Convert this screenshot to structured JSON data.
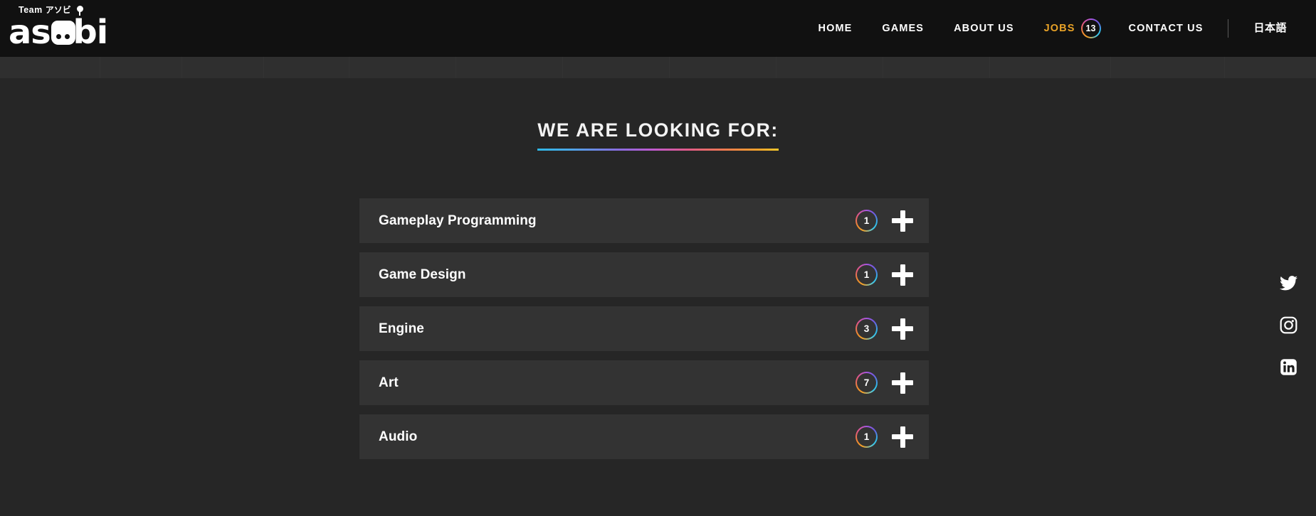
{
  "header": {
    "logo": {
      "team_text": "Team",
      "kana_text": "アソビ",
      "word": "asobi"
    },
    "nav": [
      {
        "label": "HOME",
        "active": false
      },
      {
        "label": "GAMES",
        "active": false
      },
      {
        "label": "ABOUT US",
        "active": false
      },
      {
        "label": "JOBS",
        "active": true,
        "badge": "13"
      },
      {
        "label": "CONTACT US",
        "active": false
      }
    ],
    "language_label": "日本語"
  },
  "main": {
    "heading": "WE ARE LOOKING FOR:",
    "jobs": [
      {
        "title": "Gameplay Programming",
        "count": "1",
        "expand_icon": "plus-icon"
      },
      {
        "title": "Game Design",
        "count": "1",
        "expand_icon": "plus-icon"
      },
      {
        "title": "Engine",
        "count": "3",
        "expand_icon": "plus-icon"
      },
      {
        "title": "Art",
        "count": "7",
        "expand_icon": "plus-icon"
      },
      {
        "title": "Audio",
        "count": "1",
        "expand_icon": "plus-icon"
      }
    ]
  },
  "social": [
    {
      "name": "twitter-icon",
      "label": "Twitter"
    },
    {
      "name": "instagram-icon",
      "label": "Instagram"
    },
    {
      "name": "linkedin-icon",
      "label": "LinkedIn"
    }
  ],
  "colors": {
    "header_bg": "#111111",
    "page_bg": "#262626",
    "subbar_bg": "#2f2f2f",
    "card_bg": "#333333",
    "accent_active": "#e8a227",
    "gradient_start": "#2fb8e6",
    "gradient_mid": "#c05ad0",
    "gradient_end": "#f2c62c",
    "text_primary": "#ffffff"
  }
}
